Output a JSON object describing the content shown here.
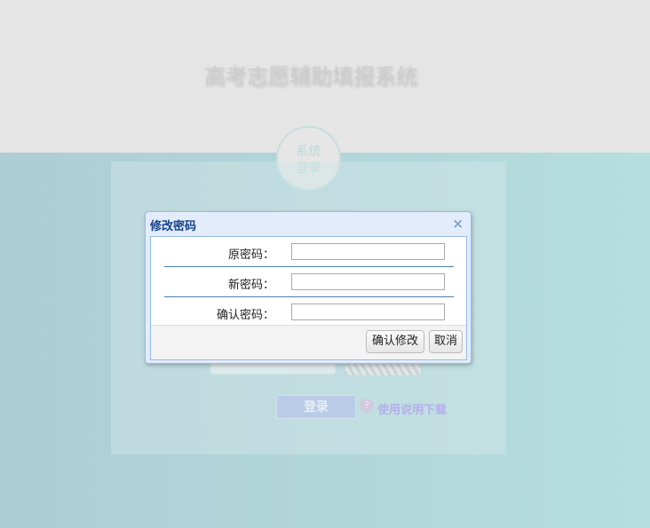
{
  "page": {
    "title": "高考志愿辅助填报系统",
    "badge_line1": "系统",
    "badge_line2": "登录",
    "login_button": "登录",
    "help_icon": "?",
    "help_link": "使用说明下载"
  },
  "dialog": {
    "title": "修改密码",
    "close": "×",
    "fields": [
      {
        "label": "原密码：",
        "value": ""
      },
      {
        "label": "新密码：",
        "value": ""
      },
      {
        "label": "确认密码：",
        "value": ""
      }
    ],
    "confirm": "确认修改",
    "cancel": "取消"
  }
}
